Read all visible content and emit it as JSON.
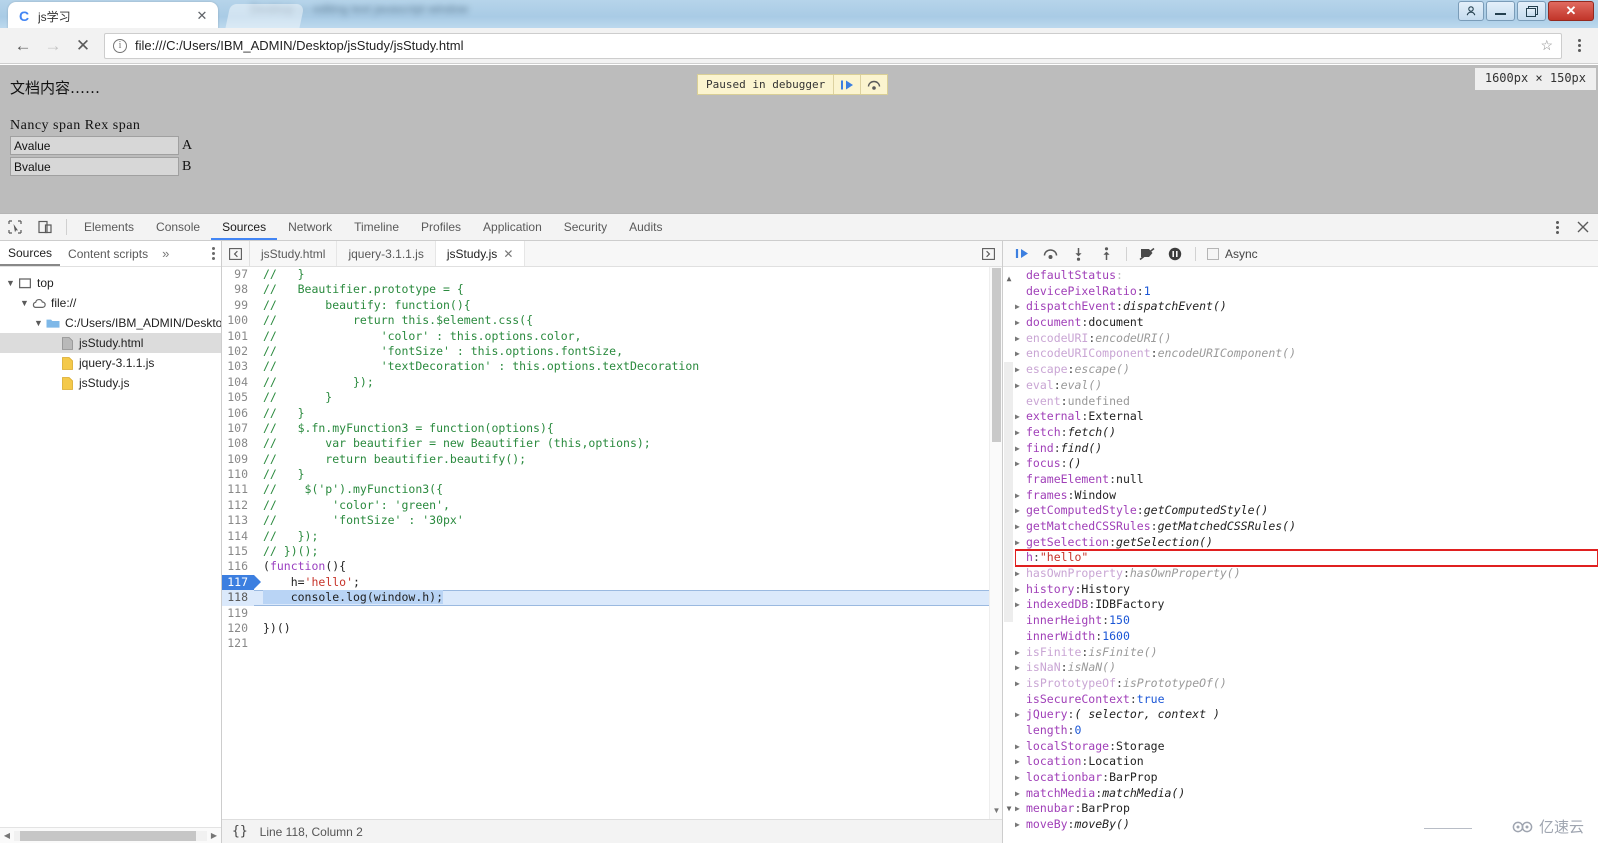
{
  "window": {
    "background_text": "blurred window behind",
    "buttons": {
      "user": "user-account",
      "minimize": "–",
      "restore": "❐",
      "close": "✕"
    }
  },
  "browser": {
    "tab": {
      "title": "js学习",
      "favicon": "C",
      "close": "✕"
    },
    "nav": {
      "back": "←",
      "forward": "→",
      "stop": "✕"
    },
    "omnibox": {
      "url": "file:///C:/Users/IBM_ADMIN/Desktop/jsStudy/jsStudy.html",
      "info_icon": "ⓘ",
      "bookmark_icon": "☆"
    },
    "menu": "chrome-menu"
  },
  "page": {
    "doc_title": "文档内容……",
    "span_line": "Nancy span Rex span",
    "fields": [
      {
        "value": "Avalue",
        "label": "A"
      },
      {
        "value": "Bvalue",
        "label": "B"
      }
    ]
  },
  "paused_bar": {
    "message": "Paused in debugger",
    "resume_icon": "resume-script",
    "step_over_icon": "step-over"
  },
  "size_tooltip": "1600px × 150px",
  "devtools": {
    "tabs": [
      {
        "label": "Elements",
        "active": false
      },
      {
        "label": "Console",
        "active": false
      },
      {
        "label": "Sources",
        "active": true
      },
      {
        "label": "Network",
        "active": false
      },
      {
        "label": "Timeline",
        "active": false
      },
      {
        "label": "Profiles",
        "active": false
      },
      {
        "label": "Application",
        "active": false
      },
      {
        "label": "Security",
        "active": false
      },
      {
        "label": "Audits",
        "active": false
      }
    ],
    "inspect_icon": "inspect-element",
    "device_icon": "toggle-device-toolbar",
    "more_icon": "more-options",
    "close_icon": "close-devtools",
    "navigator": {
      "tabs": [
        {
          "label": "Sources",
          "active": true
        },
        {
          "label": "Content scripts",
          "active": false
        }
      ],
      "more": "»",
      "options_icon": "navigator-options",
      "tree": [
        {
          "depth": 0,
          "twisty": "▼",
          "icon": "frame-icon",
          "label": "top",
          "selected": false
        },
        {
          "depth": 1,
          "twisty": "▼",
          "icon": "cloud-icon",
          "label": "file://",
          "selected": false
        },
        {
          "depth": 2,
          "twisty": "▼",
          "icon": "folder-icon",
          "label": "C:/Users/IBM_ADMIN/Desktop/",
          "selected": false
        },
        {
          "depth": 3,
          "twisty": "",
          "icon": "document-icon",
          "label": "jsStudy.html",
          "selected": true
        },
        {
          "depth": 3,
          "twisty": "",
          "icon": "script-icon",
          "label": "jquery-3.1.1.js",
          "selected": false
        },
        {
          "depth": 3,
          "twisty": "",
          "icon": "script-icon",
          "label": "jsStudy.js",
          "selected": false
        }
      ]
    },
    "source_tabs": [
      {
        "label": "jsStudy.html",
        "active": false,
        "closable": false
      },
      {
        "label": "jquery-3.1.1.js",
        "active": false,
        "closable": false
      },
      {
        "label": "jsStudy.js",
        "active": true,
        "closable": true,
        "close": "✕"
      }
    ],
    "collapse_icon": "collapse-navigator",
    "editor": {
      "lines": [
        {
          "n": 97,
          "segments": [
            {
              "t": "//   }",
              "c": "cmt"
            }
          ]
        },
        {
          "n": 98,
          "segments": [
            {
              "t": "//   Beautifier.prototype = {",
              "c": "cmt"
            }
          ]
        },
        {
          "n": 99,
          "segments": [
            {
              "t": "//       beautify: function(){",
              "c": "cmt"
            }
          ]
        },
        {
          "n": 100,
          "segments": [
            {
              "t": "//           return this.$element.css({",
              "c": "cmt"
            }
          ]
        },
        {
          "n": 101,
          "segments": [
            {
              "t": "//               'color' : this.options.color,",
              "c": "cmt"
            }
          ]
        },
        {
          "n": 102,
          "segments": [
            {
              "t": "//               'fontSize' : this.options.fontSize,",
              "c": "cmt"
            }
          ]
        },
        {
          "n": 103,
          "segments": [
            {
              "t": "//               'textDecoration' : this.options.textDecoration",
              "c": "cmt"
            }
          ]
        },
        {
          "n": 104,
          "segments": [
            {
              "t": "//           });",
              "c": "cmt"
            }
          ]
        },
        {
          "n": 105,
          "segments": [
            {
              "t": "//       }",
              "c": "cmt"
            }
          ]
        },
        {
          "n": 106,
          "segments": [
            {
              "t": "//   }",
              "c": "cmt"
            }
          ]
        },
        {
          "n": 107,
          "segments": [
            {
              "t": "//   $.fn.myFunction3 = function(options){",
              "c": "cmt"
            }
          ]
        },
        {
          "n": 108,
          "segments": [
            {
              "t": "//       var beautifier = new Beautifier (this,options);",
              "c": "cmt"
            }
          ]
        },
        {
          "n": 109,
          "segments": [
            {
              "t": "//       return beautifier.beautify();",
              "c": "cmt"
            }
          ]
        },
        {
          "n": 110,
          "segments": [
            {
              "t": "//   }",
              "c": "cmt"
            }
          ]
        },
        {
          "n": 111,
          "segments": [
            {
              "t": "//    $('p').myFunction3({",
              "c": "cmt"
            }
          ]
        },
        {
          "n": 112,
          "segments": [
            {
              "t": "//        'color': 'green',",
              "c": "cmt"
            }
          ]
        },
        {
          "n": 113,
          "segments": [
            {
              "t": "//        'fontSize' : '30px'",
              "c": "cmt"
            }
          ]
        },
        {
          "n": 114,
          "segments": [
            {
              "t": "//   });",
              "c": "cmt"
            }
          ]
        },
        {
          "n": 115,
          "segments": [
            {
              "t": "// })();",
              "c": "cmt"
            }
          ]
        },
        {
          "n": 116,
          "segments": [
            {
              "t": "(",
              "c": ""
            },
            {
              "t": "function",
              "c": "kw"
            },
            {
              "t": "(){",
              "c": ""
            }
          ]
        },
        {
          "n": 117,
          "breakpoint": true,
          "segments": [
            {
              "t": "    h=",
              "c": ""
            },
            {
              "t": "'hello'",
              "c": "str"
            },
            {
              "t": ";",
              "c": ""
            }
          ]
        },
        {
          "n": 118,
          "executing": true,
          "selected": true,
          "segments": [
            {
              "t": "    console.log(window.h);",
              "c": ""
            }
          ]
        },
        {
          "n": 119,
          "segments": [
            {
              "t": "",
              "c": ""
            }
          ]
        },
        {
          "n": 120,
          "segments": [
            {
              "t": "})()",
              "c": ""
            }
          ]
        },
        {
          "n": 121,
          "segments": [
            {
              "t": "",
              "c": ""
            }
          ]
        }
      ]
    },
    "status": {
      "pretty_print": "{}",
      "position": "Line 118, Column 2"
    },
    "debugger_toolbar": {
      "resume": "resume-script-execution",
      "step_over": "step-over-next-function-call",
      "step_into": "step-into-next-function-call",
      "step_out": "step-out-of-current-function",
      "deactivate_breakpoints": "deactivate-breakpoints",
      "pause_on_exceptions": "pause-on-exceptions",
      "async_label": "Async",
      "async_checked": false
    },
    "scope": [
      {
        "tri": "",
        "name": "defaultStatus",
        "value": "",
        "vclass": "pval-obj",
        "dim": false,
        "clipped": true
      },
      {
        "tri": "",
        "name": "devicePixelRatio",
        "value": "1",
        "vclass": "pval-num",
        "dim": false
      },
      {
        "tri": "▶",
        "name": "dispatchEvent",
        "value": "dispatchEvent()",
        "vclass": "pval-fn",
        "dim": false
      },
      {
        "tri": "▶",
        "name": "document",
        "value": "document",
        "vclass": "pval-obj",
        "dim": false
      },
      {
        "tri": "▶",
        "name": "encodeURI",
        "value": "encodeURI()",
        "vclass": "pval-fn",
        "dim": true
      },
      {
        "tri": "▶",
        "name": "encodeURIComponent",
        "value": "encodeURIComponent()",
        "vclass": "pval-fn",
        "dim": true
      },
      {
        "tri": "▶",
        "name": "escape",
        "value": "escape()",
        "vclass": "pval-fn",
        "dim": true
      },
      {
        "tri": "▶",
        "name": "eval",
        "value": "eval()",
        "vclass": "pval-fn",
        "dim": true
      },
      {
        "tri": "",
        "name": "event",
        "value": "undefined",
        "vclass": "pval-undef",
        "dim": true
      },
      {
        "tri": "▶",
        "name": "external",
        "value": "External",
        "vclass": "pval-obj",
        "dim": false
      },
      {
        "tri": "▶",
        "name": "fetch",
        "value": "fetch()",
        "vclass": "pval-fn",
        "dim": false
      },
      {
        "tri": "▶",
        "name": "find",
        "value": "find()",
        "vclass": "pval-fn",
        "dim": false
      },
      {
        "tri": "▶",
        "name": "focus",
        "value": "()",
        "vclass": "pval-fn",
        "dim": false
      },
      {
        "tri": "",
        "name": "frameElement",
        "value": "null",
        "vclass": "pval-obj",
        "dim": false
      },
      {
        "tri": "▶",
        "name": "frames",
        "value": "Window",
        "vclass": "pval-obj",
        "dim": false
      },
      {
        "tri": "▶",
        "name": "getComputedStyle",
        "value": "getComputedStyle()",
        "vclass": "pval-fn",
        "dim": false
      },
      {
        "tri": "▶",
        "name": "getMatchedCSSRules",
        "value": "getMatchedCSSRules()",
        "vclass": "pval-fn",
        "dim": false
      },
      {
        "tri": "▶",
        "name": "getSelection",
        "value": "getSelection()",
        "vclass": "pval-fn",
        "dim": false
      },
      {
        "tri": "",
        "name": "h",
        "value": "\"hello\"",
        "vclass": "pval-str",
        "dim": false,
        "highlight": true
      },
      {
        "tri": "▶",
        "name": "hasOwnProperty",
        "value": "hasOwnProperty()",
        "vclass": "pval-fn",
        "dim": true
      },
      {
        "tri": "▶",
        "name": "history",
        "value": "History",
        "vclass": "pval-obj",
        "dim": false
      },
      {
        "tri": "▶",
        "name": "indexedDB",
        "value": "IDBFactory",
        "vclass": "pval-obj",
        "dim": false
      },
      {
        "tri": "",
        "name": "innerHeight",
        "value": "150",
        "vclass": "pval-num",
        "dim": false
      },
      {
        "tri": "",
        "name": "innerWidth",
        "value": "1600",
        "vclass": "pval-num",
        "dim": false
      },
      {
        "tri": "▶",
        "name": "isFinite",
        "value": "isFinite()",
        "vclass": "pval-fn",
        "dim": true
      },
      {
        "tri": "▶",
        "name": "isNaN",
        "value": "isNaN()",
        "vclass": "pval-fn",
        "dim": true
      },
      {
        "tri": "▶",
        "name": "isPrototypeOf",
        "value": "isPrototypeOf()",
        "vclass": "pval-fn",
        "dim": true
      },
      {
        "tri": "",
        "name": "isSecureContext",
        "value": "true",
        "vclass": "pval-num",
        "dim": false
      },
      {
        "tri": "▶",
        "name": "jQuery",
        "value": "( selector, context )",
        "vclass": "pval-fn",
        "dim": false
      },
      {
        "tri": "",
        "name": "length",
        "value": "0",
        "vclass": "pval-num",
        "dim": false
      },
      {
        "tri": "▶",
        "name": "localStorage",
        "value": "Storage",
        "vclass": "pval-obj",
        "dim": false
      },
      {
        "tri": "▶",
        "name": "location",
        "value": "Location",
        "vclass": "pval-obj",
        "dim": false
      },
      {
        "tri": "▶",
        "name": "locationbar",
        "value": "BarProp",
        "vclass": "pval-obj",
        "dim": false
      },
      {
        "tri": "▶",
        "name": "matchMedia",
        "value": "matchMedia()",
        "vclass": "pval-fn",
        "dim": false
      },
      {
        "tri": "▶",
        "name": "menubar",
        "value": "BarProp",
        "vclass": "pval-obj",
        "dim": false
      },
      {
        "tri": "▶",
        "name": "moveBy",
        "value": "moveBy()",
        "vclass": "pval-fn",
        "dim": false
      }
    ]
  },
  "watermark": {
    "text": "亿速云"
  }
}
